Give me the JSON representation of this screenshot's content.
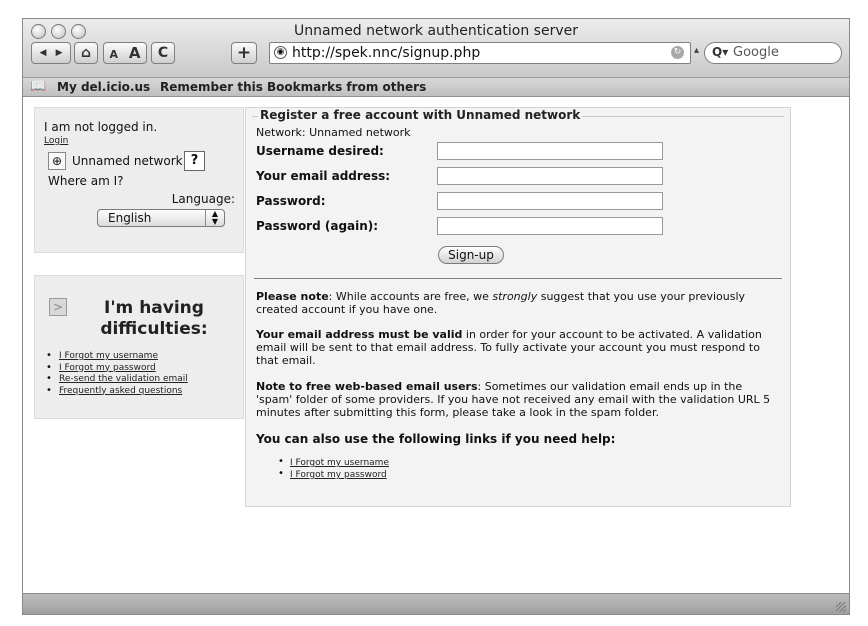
{
  "window": {
    "title": "Unnamed network authentication server"
  },
  "toolbar": {
    "back": "◀",
    "forward": "▶",
    "home": "⌂",
    "text_smaller": "A",
    "text_bigger": "A",
    "reload": "C",
    "add": "+",
    "url": "http://spek.nnc/signup.php",
    "search_placeholder": "Google",
    "search_icon": "Q▾"
  },
  "bookmarks": [
    "My del.icio.us",
    "Remember this",
    "Bookmarks from others"
  ],
  "left": {
    "status": "I am not logged in.",
    "login": "Login",
    "network_button": "Unnamed network",
    "help_button": "?",
    "where": "Where am I?",
    "language_label": "Language:",
    "language_value": "English"
  },
  "difficulties": {
    "heading_1": "I'm having",
    "heading_2": "difficulties:",
    "links": [
      "I Forgot my username",
      "I Forgot my password",
      "Re-send the validation email",
      "Frequently asked questions"
    ]
  },
  "form": {
    "legend": "Register a free account with Unnamed network",
    "network_line": "Network: Unnamed network",
    "fields": [
      {
        "label": "Username desired:",
        "value": ""
      },
      {
        "label": "Your email address:",
        "value": ""
      },
      {
        "label": "Password:",
        "value": ""
      },
      {
        "label": "Password (again):",
        "value": ""
      }
    ],
    "submit": "Sign-up"
  },
  "notes": {
    "note1_bold": "Please note",
    "note1_a": ": While accounts are free, we ",
    "note1_em": "strongly",
    "note1_b": " suggest that you use your previously created account if you have one.",
    "note2_bold": "Your email address must be valid",
    "note2_rest": " in order for your account to be activated. A validation email will be sent to that email address. To fully activate your account you must respond to that email.",
    "note3_bold": "Note to free web-based email users",
    "note3_rest": ": Sometimes our validation email ends up in the 'spam' folder of some providers. If you have not received any email with the validation URL 5 minutes after submitting this form, please take a look in the spam folder.",
    "help_heading": "You can also use the following links if you need help:",
    "help_links": [
      "I Forgot my username",
      "I Forgot my password"
    ]
  }
}
